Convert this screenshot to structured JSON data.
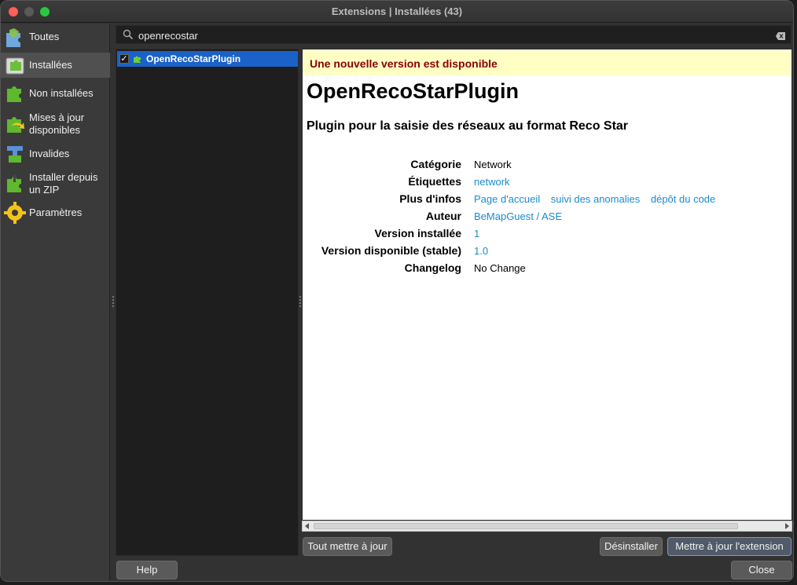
{
  "window": {
    "title": "Extensions | Installées (43)"
  },
  "sidebar": {
    "items": [
      {
        "label": "Toutes",
        "icon": "puzzle-all-icon"
      },
      {
        "label": "Installées",
        "icon": "puzzle-installed-icon"
      },
      {
        "label": "Non installées",
        "icon": "puzzle-green-icon"
      },
      {
        "label": "Mises à jour disponibles",
        "icon": "puzzle-update-icon"
      },
      {
        "label": "Invalides",
        "icon": "puzzle-invalid-icon"
      },
      {
        "label": "Installer depuis un ZIP",
        "icon": "puzzle-zip-icon"
      },
      {
        "label": "Paramètres",
        "icon": "gear-icon"
      }
    ],
    "active_index": 1
  },
  "search": {
    "value": "openrecostar"
  },
  "plugin_list": [
    {
      "name": "OpenRecoStarPlugin",
      "checked": "✓"
    }
  ],
  "details": {
    "banner": "Une nouvelle version est disponible",
    "title": "OpenRecoStarPlugin",
    "description": "Plugin pour la saisie des réseaux au format Reco Star",
    "fields": {
      "category_label": "Catégorie",
      "category_value": "Network",
      "tags_label": "Étiquettes",
      "tags_value": "network",
      "more_info_label": "Plus d'infos",
      "homepage_link": "Page d'accueil",
      "tracker_link": "suivi des anomalies",
      "repo_link": "dépôt du code",
      "author_label": "Auteur",
      "author_value": "BeMapGuest / ASE",
      "installed_label": "Version installée",
      "installed_value": "1",
      "available_label": "Version disponible (stable)",
      "available_value": "1.0",
      "changelog_label": "Changelog",
      "changelog_value": "No Change"
    }
  },
  "buttons": {
    "upgrade_all": "Tout mettre à jour",
    "uninstall": "Désinstaller",
    "upgrade": "Mettre à jour l'extension",
    "help": "Help",
    "close": "Close"
  },
  "colors": {
    "selection": "#1a62c8",
    "link": "#1a8bcf",
    "banner_bg": "#ffffc4",
    "banner_text": "#8a0000"
  }
}
